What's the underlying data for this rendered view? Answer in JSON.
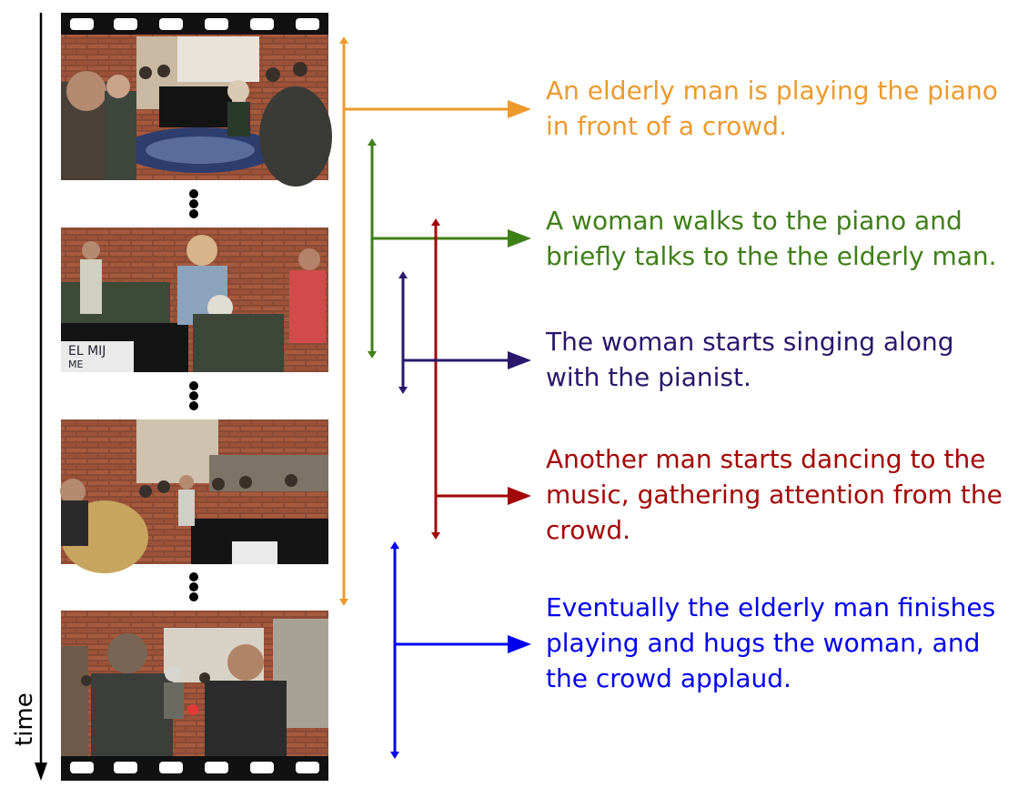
{
  "time_label": "time",
  "colors": {
    "orange": "#ec9a2e",
    "green": "#3f7f17",
    "purple": "#2a176c",
    "red": "#a30606",
    "blue": "#0000ee",
    "black": "#000000"
  },
  "frames": [
    {
      "name": "frame-1-pianist-crowd",
      "scene": "elderly-man-at-piano",
      "icon": "video-frame-icon"
    },
    {
      "name": "frame-2-woman-talks",
      "scene": "woman-by-piano",
      "icon": "video-frame-icon"
    },
    {
      "name": "frame-3-dancer",
      "scene": "man-dancing",
      "icon": "video-frame-icon"
    },
    {
      "name": "frame-4-applause",
      "scene": "crowd-applauding",
      "icon": "video-frame-icon"
    }
  ],
  "events": [
    {
      "color": "#ec9a2e",
      "lines": [
        "An elderly man is playing the piano",
        "in front of a crowd."
      ]
    },
    {
      "color": "#3f7f17",
      "lines": [
        "A woman walks to the piano and",
        "briefly talks to the the elderly man."
      ]
    },
    {
      "color": "#2a176c",
      "lines": [
        "The woman starts singing along",
        "with the pianist."
      ]
    },
    {
      "color": "#a30606",
      "lines": [
        "Another man starts dancing to the",
        "music, gathering attention from the",
        "crowd."
      ]
    },
    {
      "color": "#0000ee",
      "lines": [
        "Eventually the elderly man finishes",
        "playing and hugs the woman, and",
        "the crowd applaud."
      ]
    }
  ]
}
